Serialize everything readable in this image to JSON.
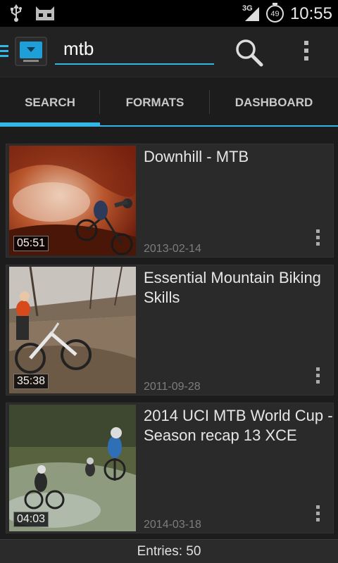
{
  "status_bar": {
    "network_type": "3G",
    "battery_level": "49",
    "time": "10:55",
    "icons": [
      "usb-icon",
      "android-icon",
      "signal-icon",
      "battery-icon"
    ]
  },
  "action_bar": {
    "search_value": "mtb",
    "search_placeholder": "",
    "icons": [
      "drawer-icon",
      "app-logo-icon",
      "search-icon",
      "overflow-menu-icon"
    ]
  },
  "tabs": [
    {
      "label": "SEARCH",
      "selected": true
    },
    {
      "label": "FORMATS",
      "selected": false
    },
    {
      "label": "DASHBOARD",
      "selected": false
    }
  ],
  "videos": [
    {
      "title": "Downhill - MTB",
      "date": "2013-02-14",
      "duration": "05:51"
    },
    {
      "title": "Essential Mountain Biking Skills",
      "date": "2011-09-28",
      "duration": "35:38"
    },
    {
      "title": "2014 UCI MTB World Cup - Season recap 13 XCE",
      "date": "2014-03-18",
      "duration": "04:03"
    }
  ],
  "footer": {
    "entries_label": "Entries: 50"
  },
  "colors": {
    "accent": "#33b5e5",
    "background": "#1c1c1c",
    "card": "#2a2a2a",
    "date_text": "#7d7d7d"
  }
}
